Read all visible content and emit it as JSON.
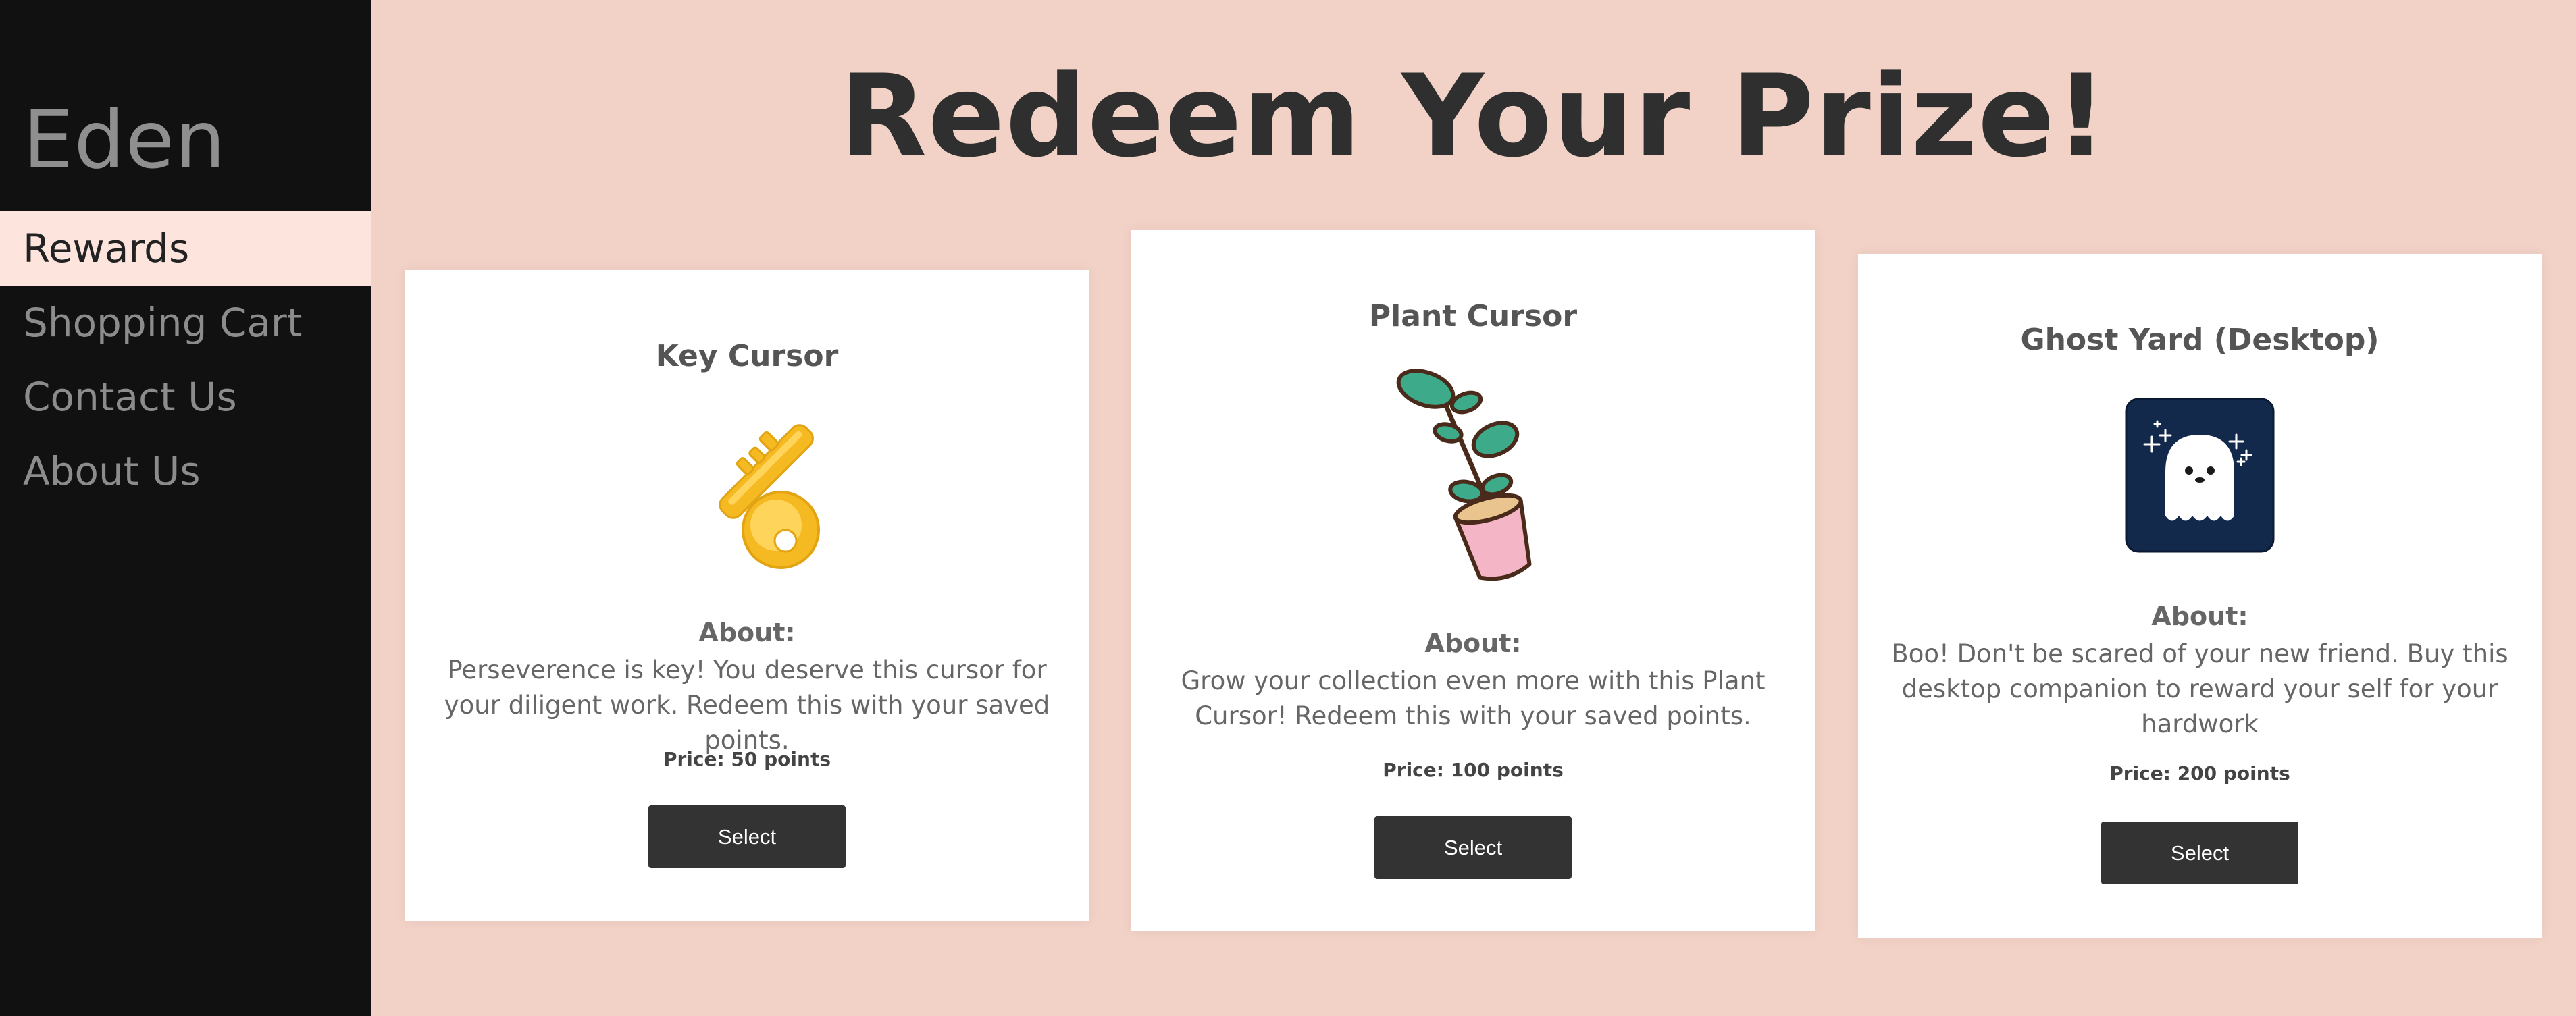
{
  "sidebar": {
    "brand": "Eden",
    "items": [
      {
        "label": "Rewards",
        "active": true
      },
      {
        "label": "Shopping Cart",
        "active": false
      },
      {
        "label": "Contact Us",
        "active": false
      },
      {
        "label": "About Us",
        "active": false
      }
    ]
  },
  "main": {
    "title": "Redeem Your Prize!",
    "cards": [
      {
        "title": "Key Cursor",
        "image": "key-icon",
        "about_label": "About:",
        "about_text": "Perseverence is key! You deserve this cursor for your diligent work. Redeem this with your saved points.",
        "price": "Price: 50 points",
        "button": "Select"
      },
      {
        "title": "Plant Cursor",
        "image": "plant-icon",
        "about_label": "About:",
        "about_text": "Grow your collection even more with this Plant Cursor! Redeem this with your saved points.",
        "price": "Price: 100 points",
        "button": "Select"
      },
      {
        "title": "Ghost Yard (Desktop)",
        "image": "ghost-icon",
        "about_label": "About:",
        "about_text": "Boo! Don't be scared of your new friend. Buy this desktop companion to reward your self for your hardwork",
        "price": "Price: 200 points",
        "button": "Select"
      }
    ]
  },
  "colors": {
    "sidebar_bg": "#111111",
    "active_item_bg": "#fde4dd",
    "page_bg": "#f2d2c7",
    "button_bg": "#333333",
    "ghost_tile_bg": "#13294b"
  }
}
